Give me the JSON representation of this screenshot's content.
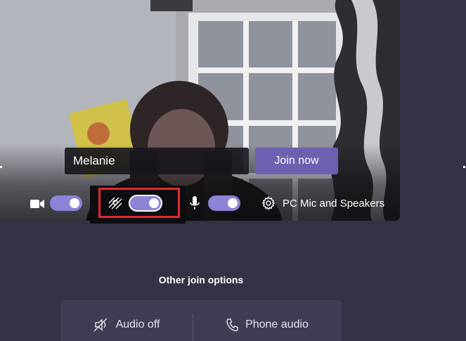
{
  "prejoin": {
    "name_value": "Melanie",
    "join_label": "Join now"
  },
  "controls": {
    "camera": {
      "icon": "camera-icon",
      "on": true
    },
    "background_blur": {
      "icon": "background-blur-icon",
      "on": true,
      "highlighted": true
    },
    "microphone": {
      "icon": "microphone-icon",
      "on": true
    },
    "device_settings": {
      "icon": "gear-icon",
      "label": "PC Mic and Speakers"
    }
  },
  "other_options": {
    "title": "Other join options",
    "audio_off_label": "Audio off",
    "audio_off_icon": "speaker-off-icon",
    "phone_audio_label": "Phone audio",
    "phone_audio_icon": "phone-icon"
  },
  "colors": {
    "background": "#363145",
    "accent": "#6b61b0",
    "toggle_on": "#8b84d7",
    "highlight_border": "#e2282f"
  }
}
